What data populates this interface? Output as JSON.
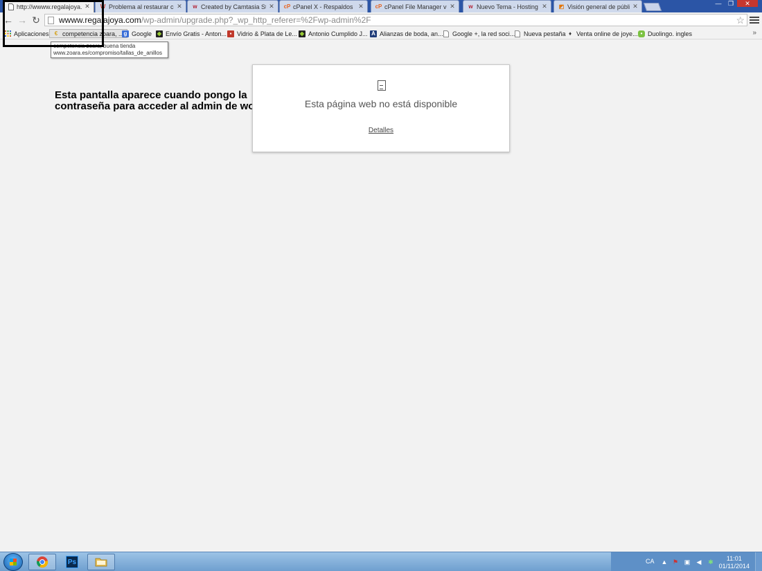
{
  "browser": {
    "tabs": [
      {
        "label": "http://wwww.regalajoya.c",
        "icon": "page-icon",
        "active": true
      },
      {
        "label": "Problema al restaurar cop",
        "icon": "wordpress-forum-icon",
        "active": false
      },
      {
        "label": "Created by Camtasia Stud",
        "icon": "webempresa-icon",
        "active": false
      },
      {
        "label": "cPanel X - Respaldos",
        "icon": "cpanel-icon",
        "active": false
      },
      {
        "label": "cPanel File Manager v3",
        "icon": "cpanel-icon",
        "active": false
      },
      {
        "label": "Nuevo Tema - Hosting W",
        "icon": "webempresa-icon",
        "active": false
      },
      {
        "label": "Visión general de público",
        "icon": "analytics-icon",
        "active": false
      }
    ],
    "address": {
      "host": "wwww.regalajoya.com",
      "path": "/wp-admin/upgrade.php?_wp_http_referer=%2Fwp-admin%2F"
    },
    "bookmarks": [
      {
        "label": "Aplicaciones",
        "icon": "apps-grid-icon"
      },
      {
        "label": "competencia zoara, ...",
        "icon": "bookmark-favicon-icon"
      },
      {
        "label": "Google",
        "icon": "google-icon"
      },
      {
        "label": "Envío Gratis - Anton...",
        "icon": "bookmark-favicon-icon"
      },
      {
        "label": "Vidrio & Plata de Le...",
        "icon": "bookmark-favicon-icon"
      },
      {
        "label": "Antonio Cumplido J...",
        "icon": "bookmark-favicon-icon"
      },
      {
        "label": "Alianzas de boda, an...",
        "icon": "bookmark-favicon-icon"
      },
      {
        "label": "Google +, la red soci...",
        "icon": "page-icon"
      },
      {
        "label": "Nueva pestaña",
        "icon": "page-icon"
      },
      {
        "label": "Venta online de joye...",
        "icon": "bookmark-favicon-icon"
      },
      {
        "label": "Duolingo. ingles",
        "icon": "duolingo-icon"
      }
    ],
    "tooltip": {
      "line1": "competencia zoara, buena tienda",
      "line2": "www.zoara.es/compromiso/tallas_de_anillos"
    }
  },
  "content": {
    "annotation": "Esta pantalla aparece cuando pongo la contraseña para acceder al admin de wordpress",
    "error": {
      "title": "Esta página web no está disponible",
      "details_link": "Detalles"
    }
  },
  "taskbar": {
    "apps": [
      {
        "name": "chrome",
        "icon": "chrome-icon"
      },
      {
        "name": "photoshop",
        "icon": "photoshop-icon",
        "label": "Ps"
      },
      {
        "name": "explorer",
        "icon": "folder-icon"
      }
    ],
    "language": "CA",
    "time": "11:01",
    "date": "01/11/2014"
  },
  "colors": {
    "tabstrip": "#2b55a6",
    "taskbar": "#6f9fcf",
    "highlight_border": "#000000"
  }
}
